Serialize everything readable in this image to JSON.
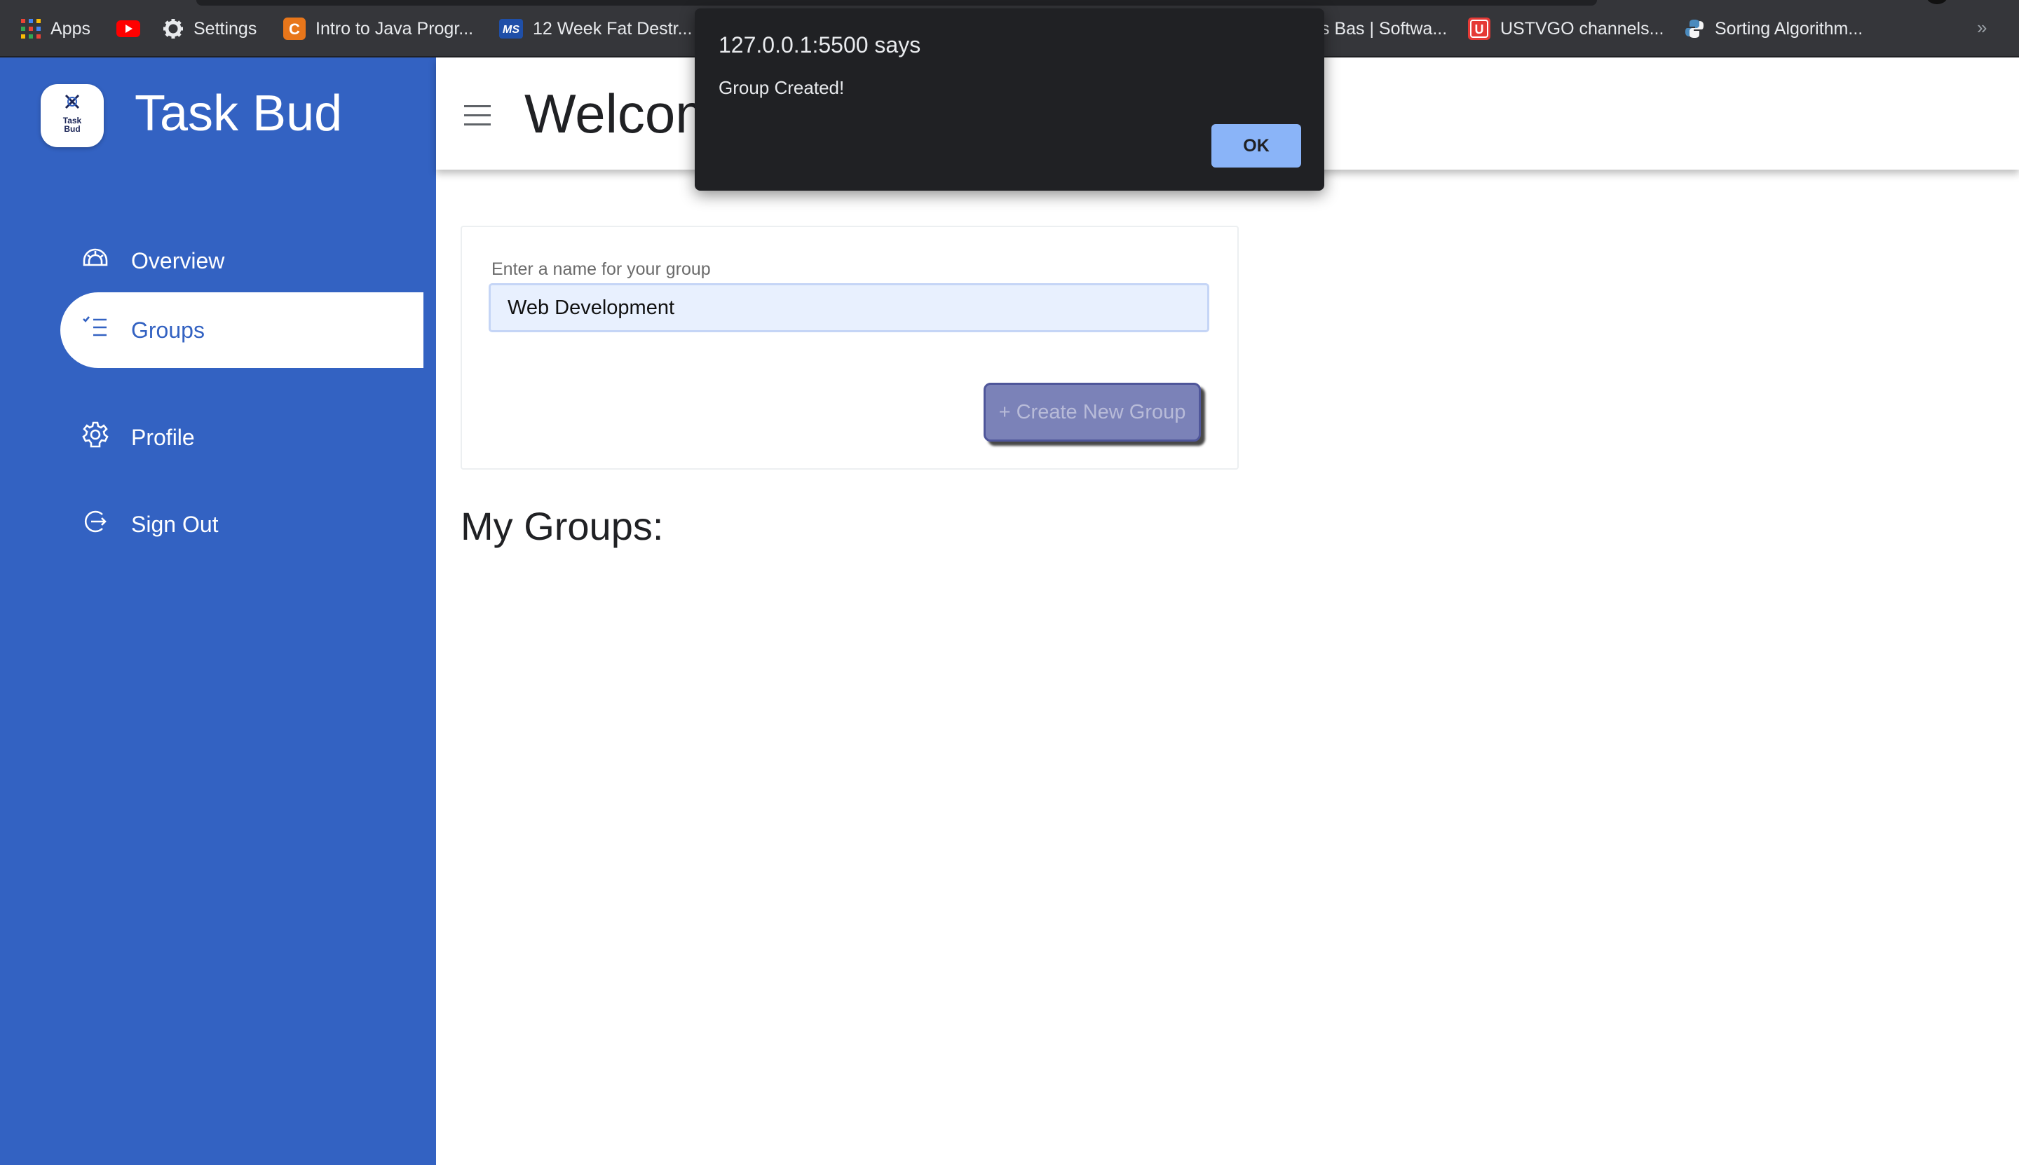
{
  "bookmarks": {
    "items": [
      {
        "label": "Apps",
        "icon": "apps-grid-icon"
      },
      {
        "label": "",
        "icon": "youtube-icon"
      },
      {
        "label": "Settings",
        "icon": "gear-icon"
      },
      {
        "label": "Intro to Java Progr...",
        "icon": "c-brand-icon"
      },
      {
        "label": "12 Week Fat Destr...",
        "icon": "ms-brand-icon"
      },
      {
        "label": "s Bas | Softwa...",
        "icon": ""
      },
      {
        "label": "USTVGO channels...",
        "icon": "u-brand-icon"
      },
      {
        "label": "Sorting Algorithm...",
        "icon": "python-icon"
      }
    ],
    "more": "»"
  },
  "sidebar": {
    "logo_text_1": "Task",
    "logo_text_2": "Bud",
    "app_title": "Task Bud",
    "nav": [
      {
        "label": "Overview",
        "icon": "dashboard-gauge-icon"
      },
      {
        "label": "Groups",
        "icon": "checklist-icon",
        "active": true
      },
      {
        "label": "Profile",
        "icon": "gear-icon"
      },
      {
        "label": "Sign Out",
        "icon": "sign-out-icon"
      }
    ],
    "color": "#3362c2"
  },
  "header": {
    "title": "Welcom"
  },
  "create_group": {
    "label": "Enter a name for your group",
    "value": "Web Development",
    "button_label": "+ Create New Group"
  },
  "my_groups": {
    "title": "My Groups:"
  },
  "alert": {
    "title": "127.0.0.1:5500 says",
    "message": "Group Created!",
    "ok_label": "OK"
  }
}
